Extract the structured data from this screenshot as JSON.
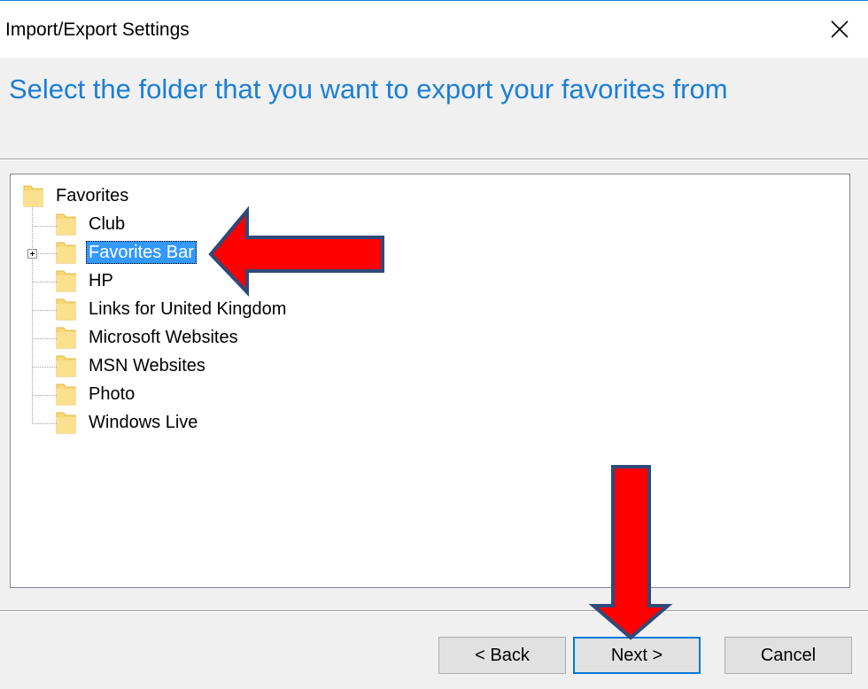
{
  "window": {
    "title": "Import/Export Settings",
    "close_icon": "close-icon"
  },
  "header": {
    "heading": "Select the folder that you want to export your favorites from"
  },
  "tree": {
    "root": {
      "label": "Favorites",
      "icon": "folder-icon"
    },
    "children": [
      {
        "label": "Club",
        "icon": "folder-icon"
      },
      {
        "label": "Favorites Bar",
        "icon": "folder-icon",
        "selected": true,
        "expandable": true
      },
      {
        "label": "HP",
        "icon": "folder-icon"
      },
      {
        "label": "Links for United Kingdom",
        "icon": "folder-icon"
      },
      {
        "label": "Microsoft Websites",
        "icon": "folder-icon"
      },
      {
        "label": "MSN Websites",
        "icon": "folder-icon"
      },
      {
        "label": "Photo",
        "icon": "folder-icon"
      },
      {
        "label": "Windows Live",
        "icon": "folder-icon"
      }
    ]
  },
  "buttons": {
    "back": "< Back",
    "next": "Next >",
    "cancel": "Cancel"
  },
  "colors": {
    "heading_blue": "#1b7fd6",
    "selection_blue": "#3399ff",
    "annotation_arrow_red": "#ff0000",
    "annotation_arrow_outline": "#2e4a7a",
    "folder_yellow": "#f8d775"
  }
}
